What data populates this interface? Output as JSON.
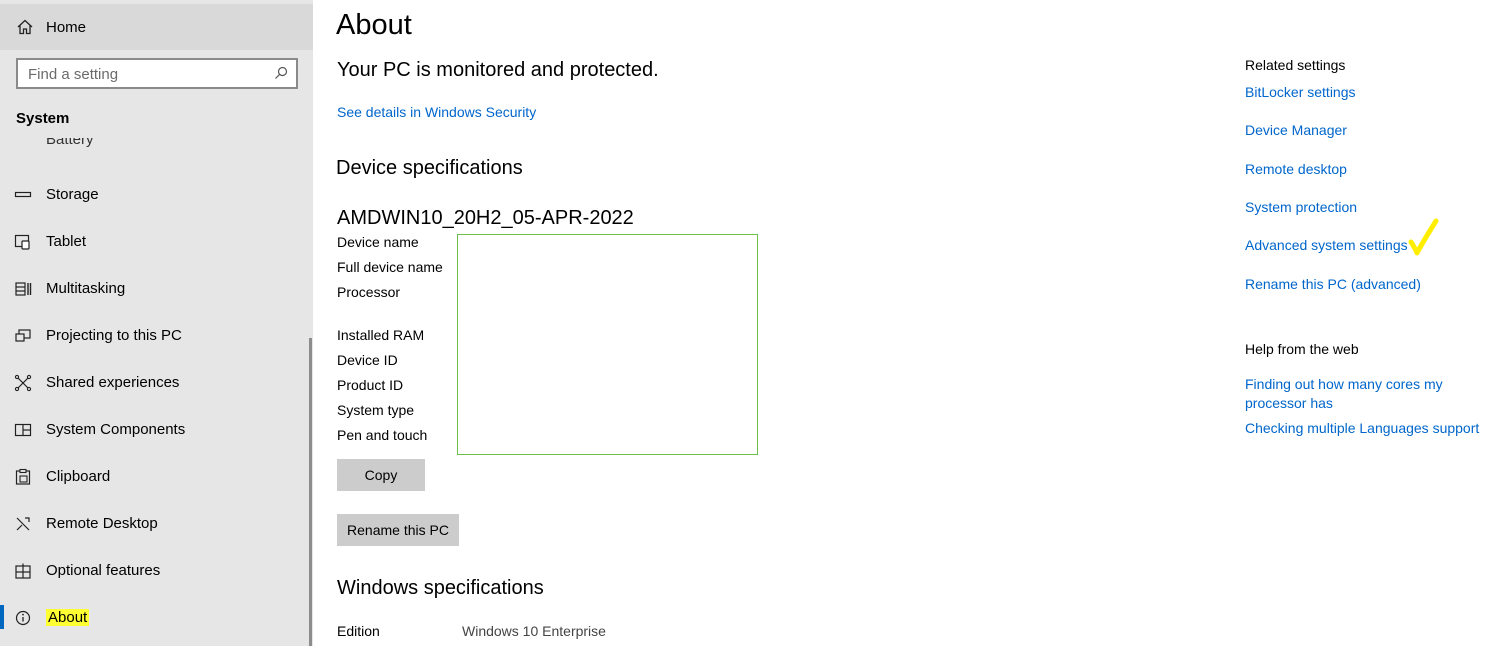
{
  "sidebar": {
    "home_label": "Home",
    "search_placeholder": "Find a setting",
    "section_title": "System",
    "cut_item_label": "Battery",
    "items": [
      {
        "label": "Storage",
        "icon": "storage-icon"
      },
      {
        "label": "Tablet",
        "icon": "tablet-icon"
      },
      {
        "label": "Multitasking",
        "icon": "multitasking-icon"
      },
      {
        "label": "Projecting to this PC",
        "icon": "projecting-icon"
      },
      {
        "label": "Shared experiences",
        "icon": "shared-experiences-icon"
      },
      {
        "label": "System Components",
        "icon": "system-components-icon"
      },
      {
        "label": "Clipboard",
        "icon": "clipboard-icon"
      },
      {
        "label": "Remote Desktop",
        "icon": "remote-desktop-icon"
      },
      {
        "label": "Optional features",
        "icon": "optional-features-icon"
      },
      {
        "label": "About",
        "icon": "info-icon",
        "active": true,
        "highlighted": true
      }
    ]
  },
  "main": {
    "title": "About",
    "protection_status": "Your PC is monitored and protected.",
    "security_link": "See details in Windows Security",
    "device_specs": {
      "heading": "Device specifications",
      "device_name_header": "AMDWIN10_20H2_05-APR-2022",
      "labels": [
        "Device name",
        "Full device name",
        "Processor",
        "Installed RAM",
        "Device ID",
        "Product ID",
        "System type",
        "Pen and touch"
      ],
      "copy_button": "Copy",
      "rename_button": "Rename this PC"
    },
    "windows_specs": {
      "heading": "Windows specifications",
      "edition_label": "Edition",
      "edition_value": "Windows 10 Enterprise"
    }
  },
  "related": {
    "heading": "Related settings",
    "links": [
      "BitLocker settings",
      "Device Manager",
      "Remote desktop",
      "System protection",
      "Advanced system settings",
      "Rename this PC (advanced)"
    ],
    "help_heading": "Help from the web",
    "help_links": [
      "Finding out how many cores my processor has",
      "Checking multiple Languages support"
    ]
  },
  "colors": {
    "link": "#0066cc",
    "highlight": "#ffff33",
    "accent": "#0067c0",
    "sidebar_bg": "#e6e6e6",
    "redaction_border": "#6cc04a"
  }
}
